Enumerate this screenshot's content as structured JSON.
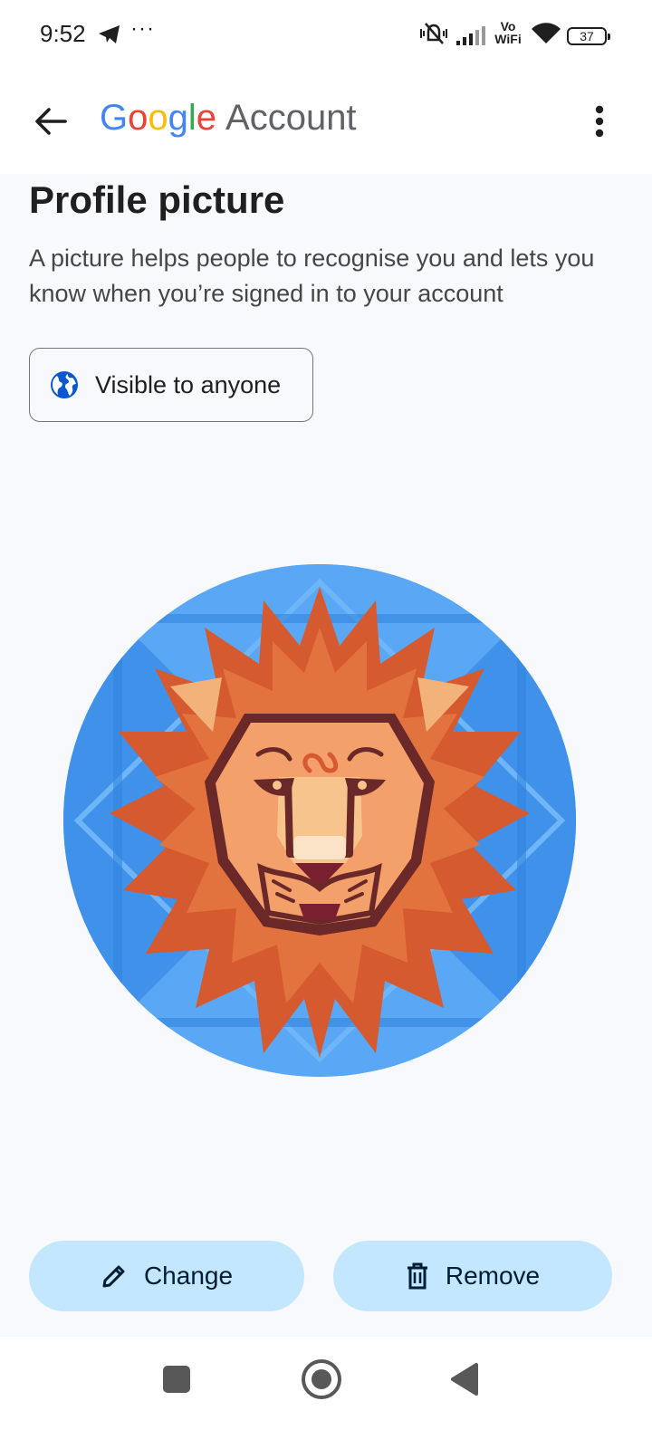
{
  "status_bar": {
    "time": "9:52",
    "more": "···",
    "vowifi_top": "Vo",
    "vowifi_bottom": "WiFi",
    "battery": "37"
  },
  "app_bar": {
    "logo_google": [
      "G",
      "o",
      "o",
      "g",
      "l",
      "e"
    ],
    "logo_account": "Account"
  },
  "page": {
    "title": "Profile picture",
    "description": "A picture helps people to recognise you and lets you know when you’re signed in to your account",
    "visibility_label": "Visible to anyone"
  },
  "actions": {
    "change_label": "Change",
    "remove_label": "Remove"
  },
  "colors": {
    "accent_button": "#c2e7ff",
    "avatar_background": "#4a9cf0",
    "google_blue": "#4285f4",
    "google_red": "#ea4335",
    "google_yellow": "#fbbc05",
    "google_green": "#34a853"
  },
  "icons": {
    "back": "arrow-back-icon",
    "menu": "more-vert-icon",
    "visibility": "globe-icon",
    "change": "pencil-icon",
    "remove": "trash-icon"
  }
}
